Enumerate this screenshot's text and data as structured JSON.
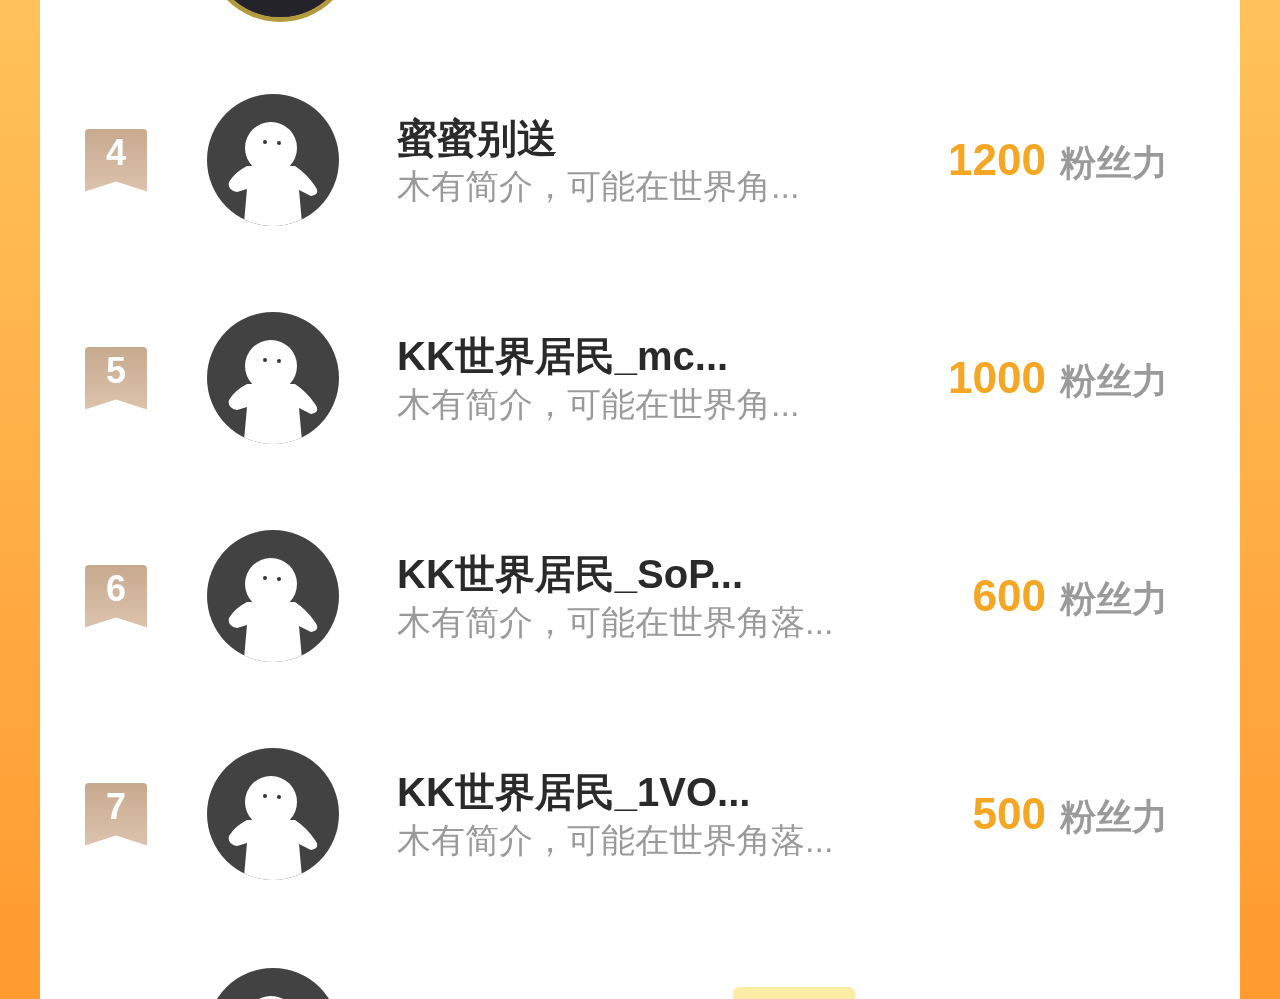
{
  "rows": [
    {
      "rank": "4",
      "name": "蜜蜜别送",
      "bio": "木有简介，可能在世界角...",
      "score": "1200",
      "unit": "粉丝力"
    },
    {
      "rank": "5",
      "name": "KK世界居民_mc...",
      "bio": "木有简介，可能在世界角...",
      "score": "1000",
      "unit": "粉丝力"
    },
    {
      "rank": "6",
      "name": "KK世界居民_SoP...",
      "bio": "木有简介，可能在世界角落...",
      "score": "600",
      "unit": "粉丝力"
    },
    {
      "rank": "7",
      "name": "KK世界居民_1VO...",
      "bio": "木有简介，可能在世界角落...",
      "score": "500",
      "unit": "粉丝力"
    }
  ],
  "partial_row": {
    "has_badge": true
  }
}
